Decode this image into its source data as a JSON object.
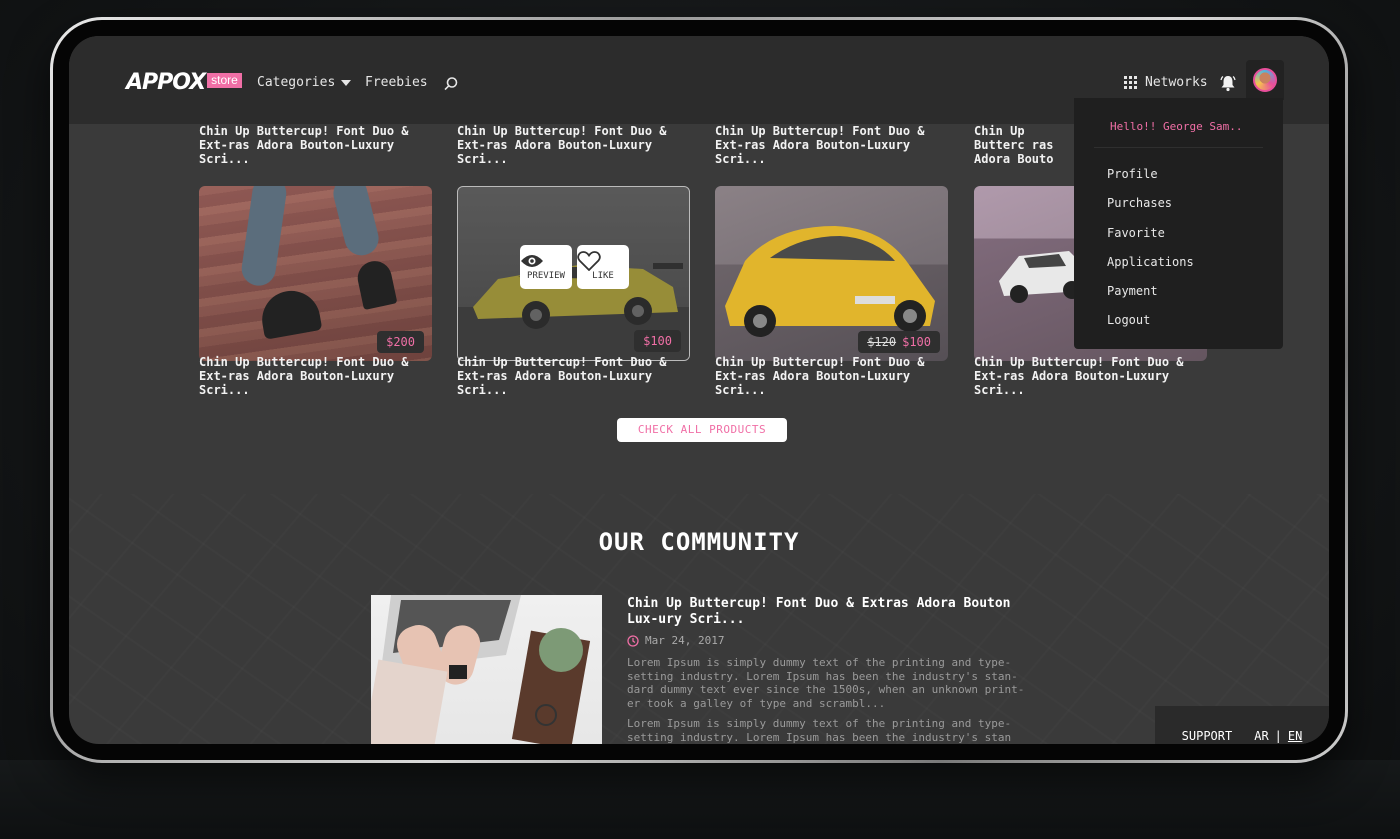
{
  "header": {
    "logo": "APPOX",
    "logo_badge": "store",
    "nav": {
      "categories": "Categories",
      "freebies": "Freebies"
    },
    "networks": "Networks"
  },
  "dropdown": {
    "greeting": "Hello!! George Sam..",
    "items": [
      "Profile",
      "Purchases",
      "Favorite",
      "Applications",
      "Payment",
      "Logout"
    ]
  },
  "products": {
    "top_titles": [
      "Chin Up Buttercup! Font Duo & Ext-ras Adora Bouton-Luxury Scri...",
      "Chin Up Buttercup! Font Duo & Ext-ras Adora Bouton-Luxury Scri...",
      "Chin Up Buttercup! Font Duo & Ext-ras Adora Bouton-Luxury Scri...",
      "Chin Up Butterc ras Adora Bouto"
    ],
    "cards": [
      {
        "title": "Chin Up Buttercup! Font Duo & Ext-ras Adora Bouton-Luxury Scri...",
        "price": "$200"
      },
      {
        "title": "Chin Up Buttercup! Font Duo & Ext-ras Adora Bouton-Luxury Scri...",
        "price": "$100",
        "preview": "PREVIEW",
        "like": "LIKE"
      },
      {
        "title": "Chin Up Buttercup! Font Duo & Ext-ras Adora Bouton-Luxury Scri...",
        "old_price": "$120",
        "price": "$100"
      },
      {
        "title": "Chin Up Buttercup! Font Duo & Ext-ras Adora Bouton-Luxury Scri..."
      }
    ],
    "check_all": "CHECK ALL PRODUCTS"
  },
  "community": {
    "heading": "OUR COMMUNITY",
    "post": {
      "title": "Chin Up Buttercup! Font Duo & Extras Adora Bouton Lux-ury Scri...",
      "date": "Mar 24, 2017",
      "para1": "Lorem Ipsum is simply dummy text of the printing and type-setting industry. Lorem Ipsum has been the industry's stan-dard dummy text ever since the 1500s, when an unknown print-er took a galley of type and scrambl...",
      "para2": "Lorem Ipsum is simply dummy text of the printing and type-setting industry. Lorem Ipsum has been the industry's stan once took a galley of type and scrambl"
    }
  },
  "footer": {
    "support": "SUPPORT",
    "lang_ar": "AR",
    "lang_sep": "|",
    "lang_en": "EN"
  },
  "colors": {
    "accent": "#f06fa6",
    "header_bg": "#2c2c2c",
    "screen_bg": "#3a3a3a"
  }
}
